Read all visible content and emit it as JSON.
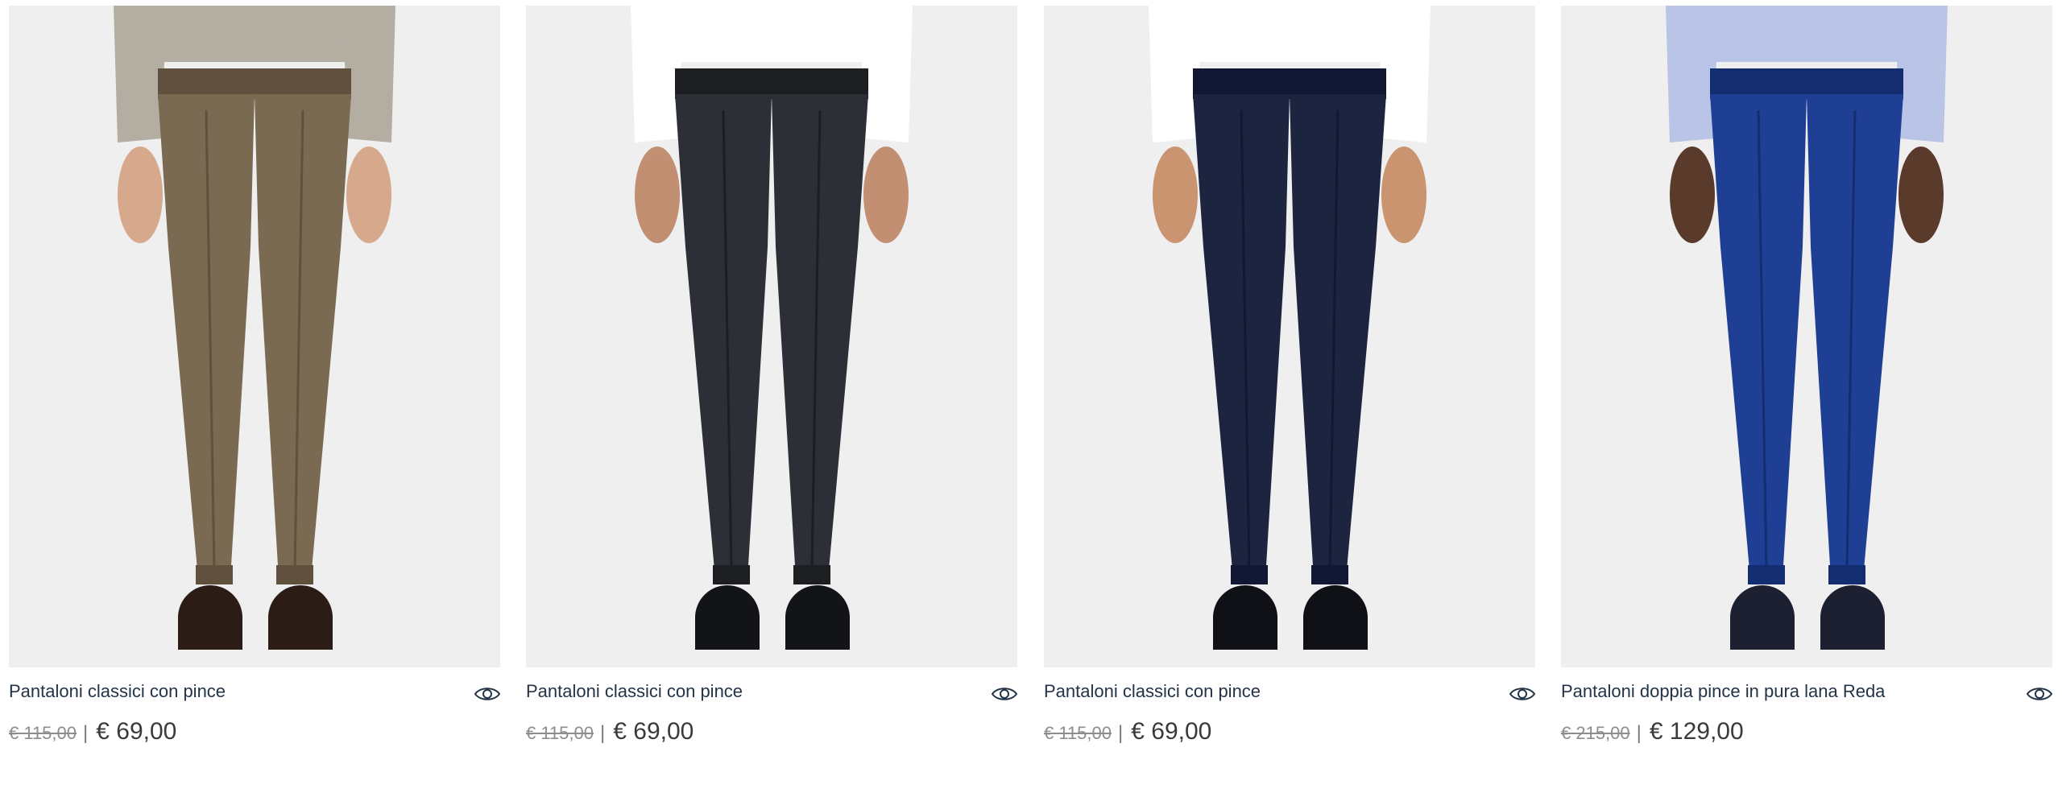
{
  "products": [
    {
      "name": "Pantaloni classici con pince",
      "old_price": "€ 115,00",
      "separator": "|",
      "price": "€ 69,00",
      "quick_view_icon": "eye-icon",
      "colors": {
        "trouser": "#7a6a52",
        "trouser_shade": "#5f513d",
        "top": "#b3ada2",
        "shoe": "#2b1c16",
        "skin": "#d6a98c"
      }
    },
    {
      "name": "Pantaloni classici con pince",
      "old_price": "€ 115,00",
      "separator": "|",
      "price": "€ 69,00",
      "quick_view_icon": "eye-icon",
      "colors": {
        "trouser": "#2c2f35",
        "trouser_shade": "#1c1e22",
        "top": "#ffffff",
        "shoe": "#121418",
        "skin": "#c28f73"
      }
    },
    {
      "name": "Pantaloni classici con pince",
      "old_price": "€ 115,00",
      "separator": "|",
      "price": "€ 69,00",
      "quick_view_icon": "eye-icon",
      "colors": {
        "trouser": "#1c2440",
        "trouser_shade": "#121833",
        "top": "#ffffff",
        "shoe": "#0f1116",
        "skin": "#c9946f"
      }
    },
    {
      "name": "Pantaloni doppia pince in pura lana Reda",
      "old_price": "€ 215,00",
      "separator": "|",
      "price": "€ 129,00",
      "quick_view_icon": "eye-icon",
      "colors": {
        "trouser": "#1f3f95",
        "trouser_shade": "#142c70",
        "top": "#b9c4e6",
        "shoe": "#1d2030",
        "skin": "#5a3a2a"
      }
    }
  ]
}
